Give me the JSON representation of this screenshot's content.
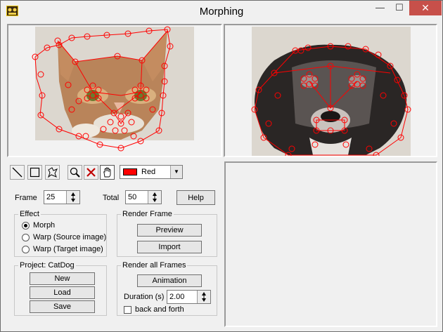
{
  "window": {
    "title": "Morphing",
    "minimize": "—",
    "maximize": "☐",
    "close": "✕"
  },
  "toolbar": {
    "tools": [
      "line-tool-icon",
      "rectangle-tool-icon",
      "polygon-tool-icon",
      "zoom-icon",
      "delete-icon",
      "hand-icon"
    ],
    "color_label": "Red",
    "color_hex": "#ff0000"
  },
  "frame": {
    "frame_label": "Frame",
    "frame_value": "25",
    "total_label": "Total",
    "total_value": "50",
    "help_label": "Help"
  },
  "effect": {
    "title": "Effect",
    "options": [
      "Morph",
      "Warp (Source image)",
      "Warp (Target image)"
    ],
    "selected": "Morph"
  },
  "render_frame": {
    "title": "Render Frame",
    "preview_label": "Preview",
    "import_label": "Import"
  },
  "project": {
    "title": "Project: CatDog",
    "new_label": "New",
    "load_label": "Load",
    "save_label": "Save"
  },
  "render_all": {
    "title": "Render all Frames",
    "animation_label": "Animation",
    "duration_label": "Duration (s)",
    "duration_value": "2.00",
    "back_and_forth_label": "back and forth",
    "back_and_forth_checked": false
  },
  "colors": {
    "marker": "#ff0000",
    "close_button": "#c7504a"
  }
}
